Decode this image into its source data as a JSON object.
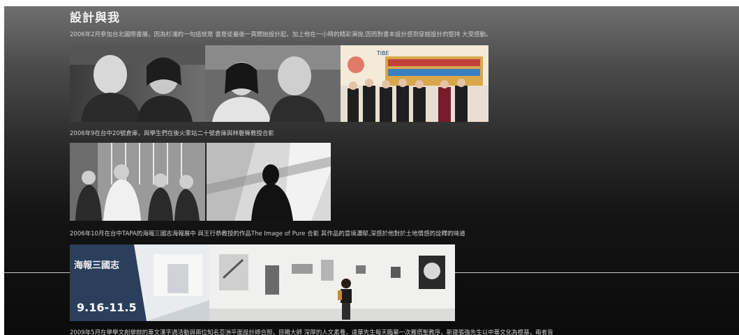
{
  "section": {
    "title": "設計與我"
  },
  "entries": [
    {
      "caption": "2006年2月參加台北國際書展，因為杉浦的一句話就是 書是從最後一頁開始設計起，加上他在一小時的精彩演說,因而對書本設計感到穿越設計的堅持 大受感動。"
    },
    {
      "caption": "2006年9在台中20號倉庫，與學生們在後火車站二十號倉庫與林磐聳教授合影"
    },
    {
      "caption": "2006年10月在台中TAPA的海報三國志海報展中 與王行恭教授的作品The Image of Pure 合影 其作品的意境濃郁,深感於他對於土地情感的詮釋的味道"
    },
    {
      "caption": "2009年5月在學學文創舉辦的華文漢字週活動與兩位知名亞洲平面設計師合照，目睹大師 深厚的人文素養，遠華先生每天臨摹一次雁塔聖教序，新建張強先生以中華文化為根基，兩者皆"
    }
  ],
  "photos": {
    "p1": "portrait-couple-bw",
    "p2": "portrait-pair-bw",
    "p3": "group-photo-book-fair",
    "p4": "group-photo-warehouse",
    "p5": "silhouette-shadow",
    "p6": "poster-exhibition-entrance",
    "p7": "exhibition-wall-portrait"
  },
  "banner_text": {
    "tibe": "TiBE",
    "poster_cn": "海報三國志",
    "poster_date": "9.16-11.5"
  }
}
